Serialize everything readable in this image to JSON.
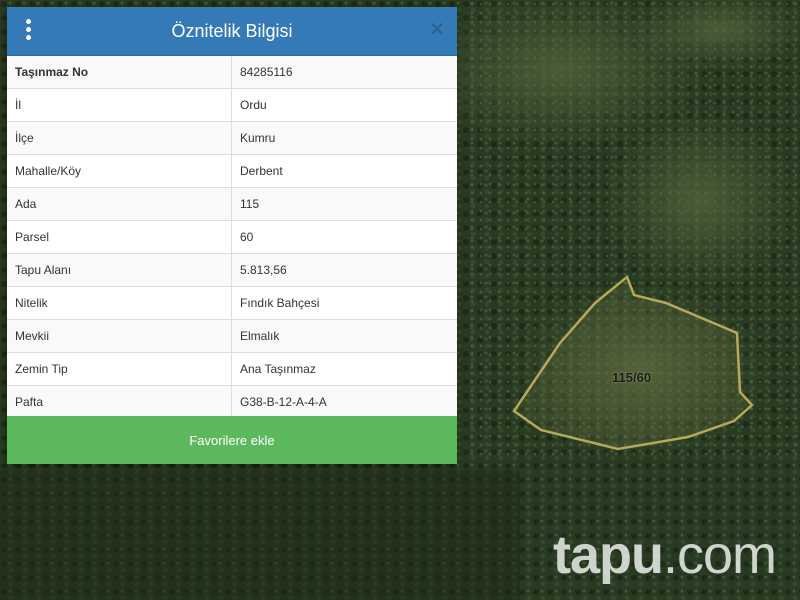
{
  "popup": {
    "title": "Öznitelik Bilgisi",
    "menu_icon": "more-vert-icon",
    "close_icon": "close-icon",
    "rows": [
      {
        "key": "Taşınmaz No",
        "value": "84285116"
      },
      {
        "key": "İl",
        "value": "Ordu"
      },
      {
        "key": "İlçe",
        "value": "Kumru"
      },
      {
        "key": "Mahalle/Köy",
        "value": "Derbent"
      },
      {
        "key": "Ada",
        "value": "115"
      },
      {
        "key": "Parsel",
        "value": "60"
      },
      {
        "key": "Tapu Alanı",
        "value": "5.813,56"
      },
      {
        "key": "Nitelik",
        "value": "Fındık Bahçesi"
      },
      {
        "key": "Mevkii",
        "value": "Elmalık"
      },
      {
        "key": "Zemin Tip",
        "value": "Ana Taşınmaz"
      },
      {
        "key": "Pafta",
        "value": "G38-B-12-A-4-A"
      }
    ],
    "favorite_button": "Favorilere ekle"
  },
  "map": {
    "parcel_label": "115/60",
    "watermark_bold": "tapu",
    "watermark_light": ".com"
  },
  "colors": {
    "header": "#337ab7",
    "button": "#5cb85c",
    "parcel_outline": "#b5a95a"
  }
}
